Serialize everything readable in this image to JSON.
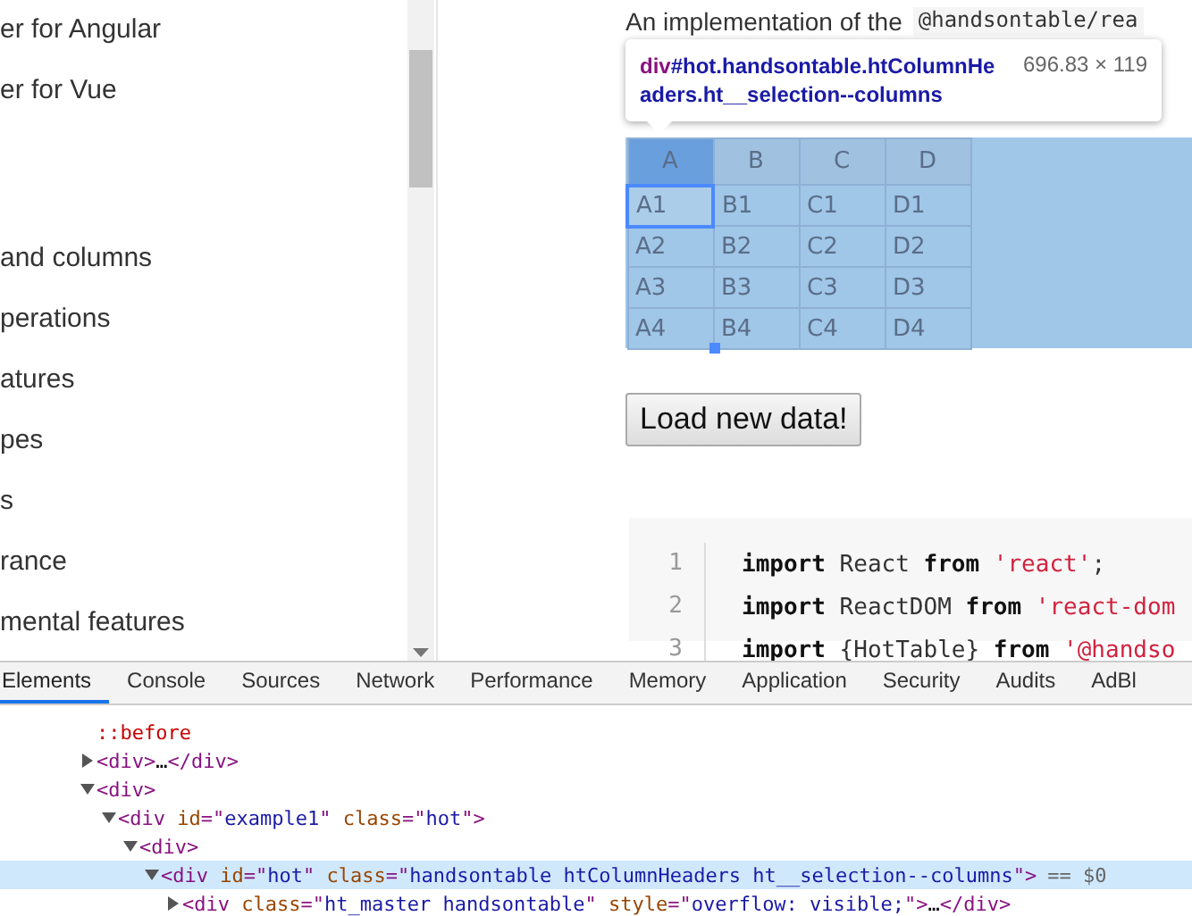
{
  "sidebar": {
    "groups": [
      [
        "er for Angular",
        "er for Vue"
      ],
      [
        "and columns",
        "perations",
        "atures",
        "pes",
        "s",
        "rance",
        "mental features"
      ]
    ]
  },
  "content": {
    "intro": "An implementation of the",
    "intro_code": "@handsontable/rea",
    "tooltip": {
      "tag": "div",
      "selector": "#hot.handsontable.htColumnHeaders.ht__selection--columns",
      "size": "696.83 × 119"
    },
    "table": {
      "highlighted": true,
      "columns": [
        {
          "label": "A",
          "selected": true
        },
        {
          "label": "B",
          "selected": false
        },
        {
          "label": "C",
          "selected": false
        },
        {
          "label": "D",
          "selected": false
        }
      ],
      "rows": [
        [
          {
            "text": "A1",
            "selected": true
          },
          {
            "text": "B1",
            "selected": false
          },
          {
            "text": "C1",
            "selected": false
          },
          {
            "text": "D1",
            "selected": false
          }
        ],
        [
          {
            "text": "A2",
            "selected": false
          },
          {
            "text": "B2",
            "selected": false
          },
          {
            "text": "C2",
            "selected": false
          },
          {
            "text": "D2",
            "selected": false
          }
        ],
        [
          {
            "text": "A3",
            "selected": false
          },
          {
            "text": "B3",
            "selected": false
          },
          {
            "text": "C3",
            "selected": false
          },
          {
            "text": "D3",
            "selected": false
          }
        ],
        [
          {
            "text": "A4",
            "selected": false
          },
          {
            "text": "B4",
            "selected": false
          },
          {
            "text": "C4",
            "selected": false
          },
          {
            "text": "D4",
            "selected": false
          }
        ]
      ]
    },
    "button": "Load new data!",
    "code": [
      {
        "number": "1",
        "tokens": [
          {
            "kind": "keyword",
            "text": "import"
          },
          {
            "kind": "plain",
            "text": " React "
          },
          {
            "kind": "keyword",
            "text": "from"
          },
          {
            "kind": "string",
            "text": " 'react'"
          },
          {
            "kind": "plain",
            "text": ";"
          }
        ]
      },
      {
        "number": "2",
        "tokens": [
          {
            "kind": "keyword",
            "text": "import"
          },
          {
            "kind": "plain",
            "text": " ReactDOM "
          },
          {
            "kind": "keyword",
            "text": "from"
          },
          {
            "kind": "string",
            "text": " 'react-dom"
          }
        ]
      },
      {
        "number": "3",
        "tokens": [
          {
            "kind": "keyword",
            "text": "import"
          },
          {
            "kind": "plain",
            "text": " {HotTable} "
          },
          {
            "kind": "keyword",
            "text": "from"
          },
          {
            "kind": "string",
            "text": " '@handso"
          }
        ]
      }
    ]
  },
  "devtools": {
    "tabs": [
      {
        "label": "Elements",
        "selected": true
      },
      {
        "label": "Console",
        "selected": false
      },
      {
        "label": "Sources",
        "selected": false
      },
      {
        "label": "Network",
        "selected": false
      },
      {
        "label": "Performance",
        "selected": false
      },
      {
        "label": "Memory",
        "selected": false
      },
      {
        "label": "Application",
        "selected": false
      },
      {
        "label": "Security",
        "selected": false
      },
      {
        "label": "Audits",
        "selected": false
      },
      {
        "label": "AdBl",
        "selected": false
      }
    ],
    "tree": [
      {
        "kind": "pseudo",
        "markup": "::before"
      },
      {
        "kind": "element",
        "markup": "<div>…</div>",
        "expanded": false,
        "selected": false
      },
      {
        "kind": "element",
        "markup": "<div>",
        "expanded": true,
        "selected": false,
        "children": [
          {
            "kind": "element",
            "markup": "<div id=\"example1\" class=\"hot\">",
            "expanded": true,
            "selected": false,
            "children": [
              {
                "kind": "element",
                "markup": "<div>",
                "expanded": true,
                "selected": false,
                "children": [
                  {
                    "kind": "element",
                    "markup": "<div id=\"hot\" class=\"handsontable htColumnHeaders ht__selection--columns\">",
                    "expanded": true,
                    "selected": true,
                    "marker": "== $0",
                    "children": [
                      {
                        "kind": "element",
                        "markup": "<div class=\"ht_master handsontable\" style=\"overflow: visible;\">…</div>",
                        "expanded": false,
                        "selected": false
                      }
                    ]
                  }
                ]
              }
            ]
          }
        ]
      }
    ]
  }
}
